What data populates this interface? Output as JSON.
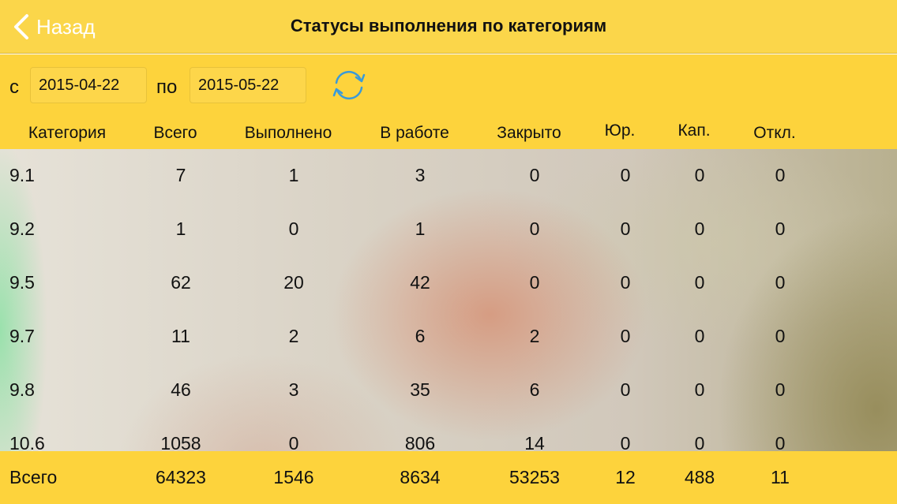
{
  "nav": {
    "back_label": "Назад",
    "title": "Статусы выполнения по категориям"
  },
  "filter": {
    "from_label": "с",
    "from_date": "2015-04-22",
    "to_label": "по",
    "to_date": "2015-05-22",
    "refresh_icon": "refresh-icon"
  },
  "table": {
    "headers": [
      "Категория",
      "Всего",
      "Выполнено",
      "В работе",
      "Закрыто",
      "Юр.",
      "Кап.",
      "Откл."
    ],
    "rows": [
      [
        "9.1",
        "7",
        "1",
        "3",
        "0",
        "0",
        "0",
        "0"
      ],
      [
        "9.2",
        "1",
        "0",
        "1",
        "0",
        "0",
        "0",
        "0"
      ],
      [
        "9.5",
        "62",
        "20",
        "42",
        "0",
        "0",
        "0",
        "0"
      ],
      [
        "9.7",
        "11",
        "2",
        "6",
        "2",
        "0",
        "0",
        "0"
      ],
      [
        "9.8",
        "46",
        "3",
        "35",
        "6",
        "0",
        "0",
        "0"
      ],
      [
        "10.6",
        "1058",
        "0",
        "806",
        "14",
        "0",
        "0",
        "0"
      ]
    ]
  },
  "totals": [
    "Всего",
    "64323",
    "1546",
    "8634",
    "53253",
    "12",
    "488",
    "11"
  ],
  "colors": {
    "accent": "#fdd33c",
    "nav": "#fbd64a",
    "back": "#ffffff",
    "refresh": "#3a9ad9"
  }
}
